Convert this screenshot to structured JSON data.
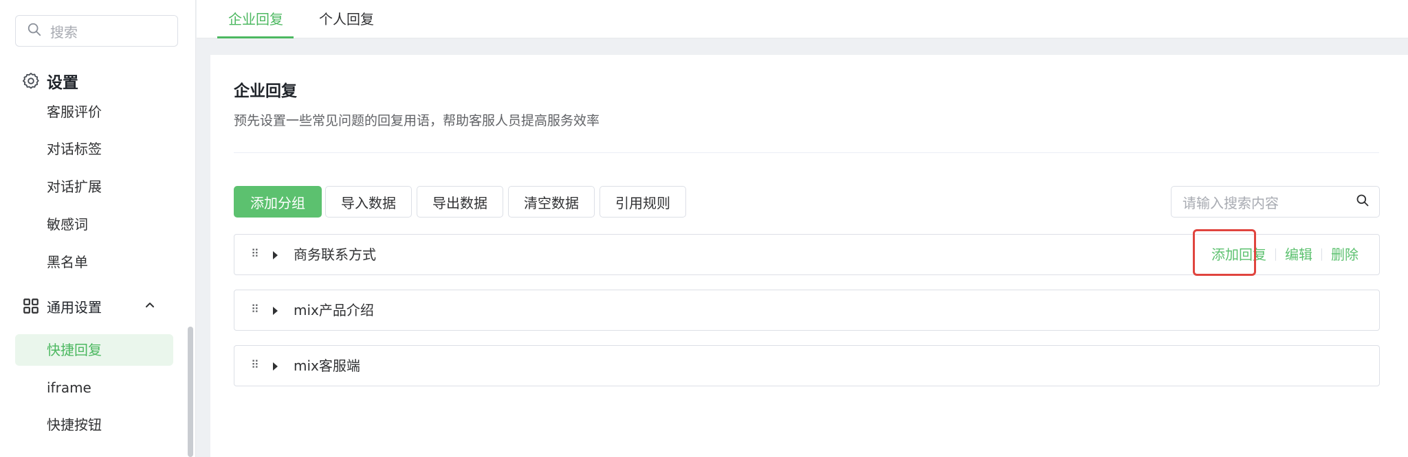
{
  "sidebar": {
    "search_placeholder": "搜索",
    "settings_section": "设置",
    "items_top": [
      "客服评价",
      "对话标签",
      "对话扩展",
      "敏感词",
      "黑名单"
    ],
    "general_section": "通用设置",
    "items_general": [
      "快捷回复",
      "iframe",
      "快捷按钮"
    ],
    "active_item": "快捷回复"
  },
  "tabs": [
    "企业回复",
    "个人回复"
  ],
  "active_tab": "企业回复",
  "page": {
    "title": "企业回复",
    "description": "预先设置一些常见问题的回复用语，帮助客服人员提高服务效率"
  },
  "toolbar": {
    "add_group": "添加分组",
    "import": "导入数据",
    "export": "导出数据",
    "clear": "清空数据",
    "rules": "引用规则",
    "search_placeholder": "请输入搜索内容"
  },
  "groups": [
    {
      "name": "商务联系方式"
    },
    {
      "name": "mix产品介绍"
    },
    {
      "name": "mix客服端"
    }
  ],
  "group_actions": {
    "add_reply": "添加回复",
    "edit": "编辑",
    "delete": "删除"
  },
  "colors": {
    "accent": "#5cc16f",
    "highlight": "#e0443e"
  }
}
